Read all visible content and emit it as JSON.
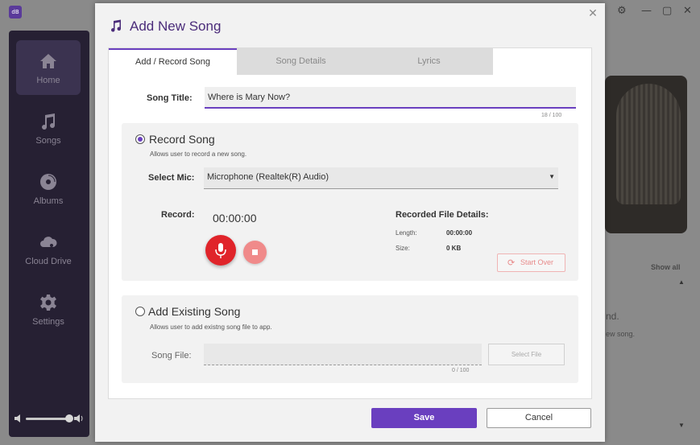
{
  "app": {
    "logo_text": "dB",
    "sidebar": {
      "items": [
        {
          "label": "Home",
          "icon": "home-icon"
        },
        {
          "label": "Songs",
          "icon": "music-note-icon"
        },
        {
          "label": "Albums",
          "icon": "disc-icon"
        },
        {
          "label": "Cloud Drive",
          "icon": "cloud-icon"
        },
        {
          "label": "Settings",
          "icon": "gear-icon"
        }
      ],
      "volume_level": 0.85
    },
    "background": {
      "show_all": "Show all",
      "partial_text_1": "nd.",
      "partial_text_2": "ew song."
    }
  },
  "dialog": {
    "title": "Add New Song",
    "title_icon": "music-note-icon",
    "tabs": [
      {
        "label": "Add / Record Song",
        "active": true
      },
      {
        "label": "Song Details",
        "active": false
      },
      {
        "label": "Lyrics",
        "active": false
      }
    ],
    "song_title": {
      "label": "Song Title:",
      "value": "Where is Mary Now?",
      "counter": "18 / 100"
    },
    "record_section": {
      "title": "Record Song",
      "selected": true,
      "description": "Allows user to record a new song.",
      "mic_label": "Select Mic:",
      "mic_value": "Microphone (Realtek(R) Audio)",
      "record_label": "Record:",
      "timer": "00:00:00",
      "details_title": "Recorded File Details:",
      "length_label": "Length:",
      "length_value": "00:00:00",
      "size_label": "Size:",
      "size_value": "0 KB",
      "start_over": "Start Over"
    },
    "existing_section": {
      "title": "Add Existing Song",
      "selected": false,
      "description": "Allows user to add existng song file to app.",
      "file_label": "Song File:",
      "file_value": "",
      "select_file": "Select File",
      "counter": "0 / 100"
    },
    "save_label": "Save",
    "cancel_label": "Cancel"
  },
  "colors": {
    "accent": "#6a3fbf",
    "record": "#e0242a",
    "stop": "#f08a8a",
    "sidebar_bg": "#262033"
  }
}
